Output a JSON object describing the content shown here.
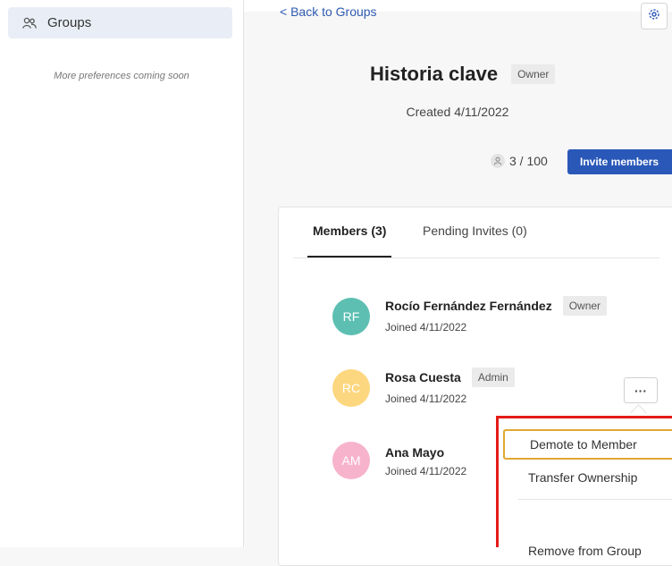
{
  "sidebar": {
    "items": [
      {
        "label": "Groups",
        "icon": "users-icon"
      }
    ],
    "note": "More preferences coming soon"
  },
  "header": {
    "back_label": "< Back to Groups",
    "settings_icon": "gear-icon"
  },
  "group": {
    "title": "Historia clave",
    "role_badge": "Owner",
    "created": "Created 4/11/2022",
    "member_count": "3 / 100",
    "invite_label": "Invite members"
  },
  "tabs": [
    {
      "label": "Members (3)",
      "active": true
    },
    {
      "label": "Pending Invites (0)",
      "active": false
    }
  ],
  "members": [
    {
      "initials": "RF",
      "name": "Rocío Fernández Fernández",
      "badge": "Owner",
      "joined": "Joined 4/11/2022",
      "color": "#5cbfb2"
    },
    {
      "initials": "RC",
      "name": "Rosa Cuesta",
      "badge": "Admin",
      "joined": "Joined 4/11/2022",
      "color": "#fdd77f"
    },
    {
      "initials": "AM",
      "name": "Ana Mayo",
      "badge": "",
      "joined": "Joined 4/11/2022",
      "color": "#f7b3cc"
    }
  ],
  "more_button_label": "···",
  "menu": {
    "items": [
      {
        "label": "Demote to Member"
      },
      {
        "label": "Transfer Ownership"
      },
      {
        "label": "Remove from Group"
      }
    ]
  },
  "colors": {
    "accent": "#2a58b8",
    "highlight_border": "#e41b17",
    "focus_border": "#e0a832"
  }
}
